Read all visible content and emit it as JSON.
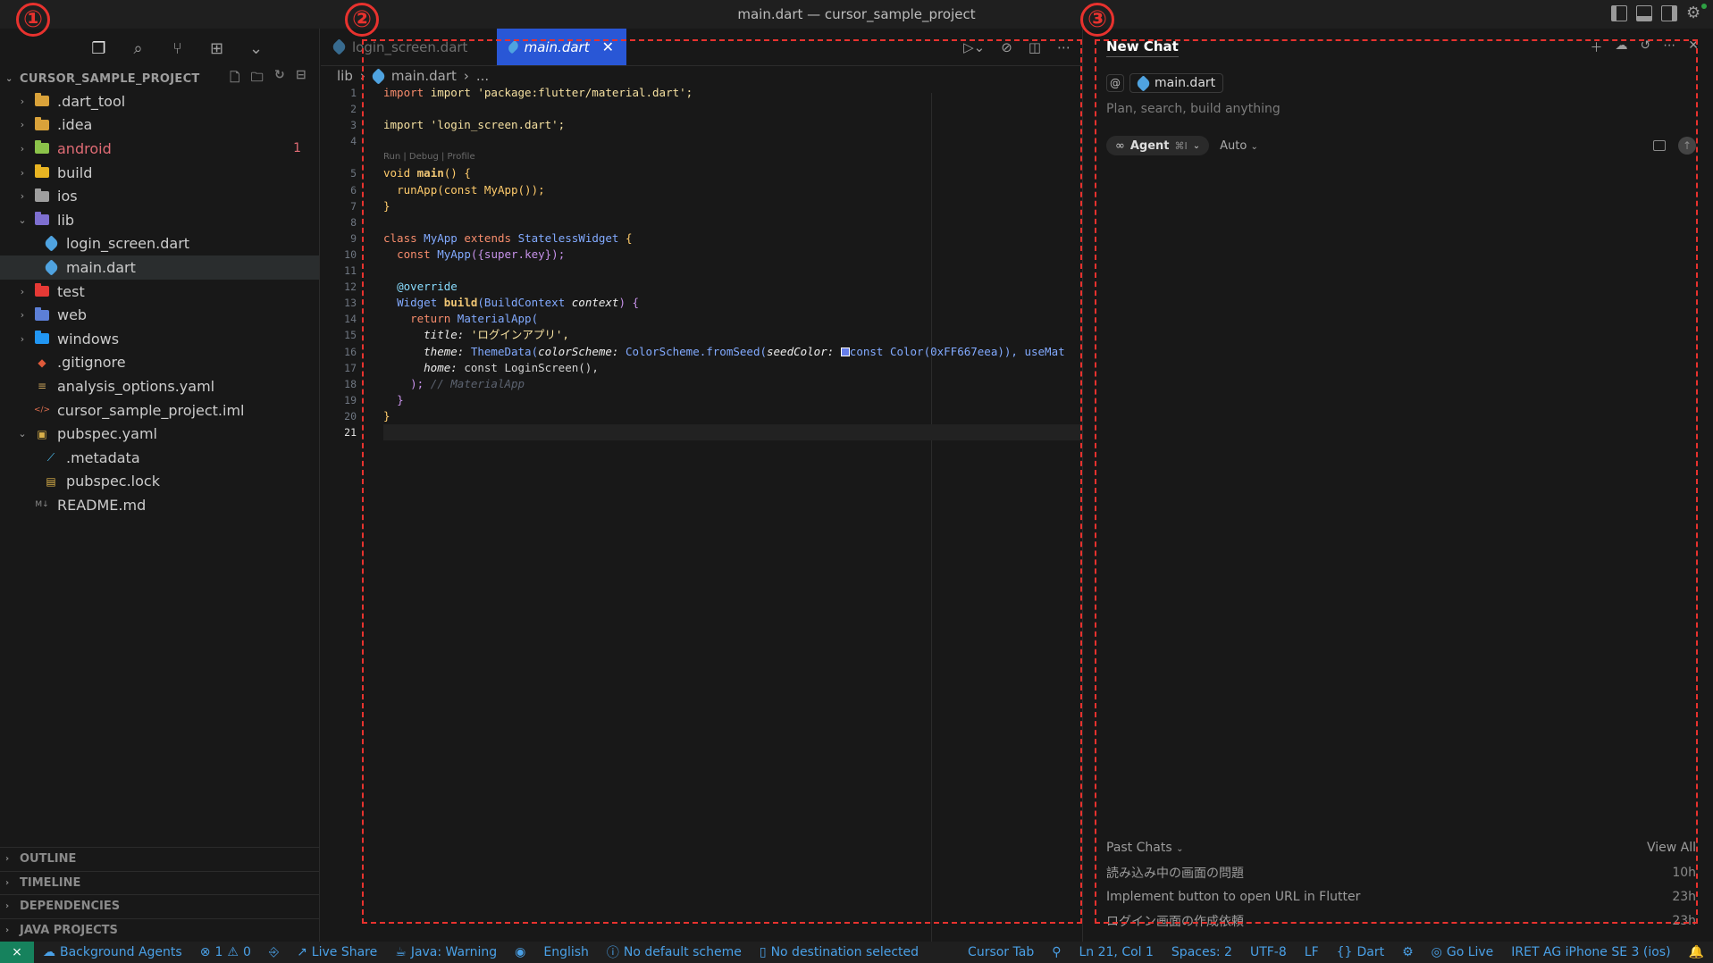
{
  "window": {
    "title": "main.dart — cursor_sample_project"
  },
  "annotations": {
    "n1": "①",
    "n2": "②",
    "n3": "③"
  },
  "explorer": {
    "title": "CURSOR_SAMPLE_PROJECT",
    "items": [
      {
        "label": ".dart_tool",
        "type": "folder",
        "color": "#d9a23a",
        "expanded": false
      },
      {
        "label": ".idea",
        "type": "folder",
        "color": "#d9a23a",
        "expanded": false
      },
      {
        "label": "android",
        "type": "folder",
        "color": "#8bc34a",
        "expanded": false,
        "badge": "1",
        "error": true
      },
      {
        "label": "build",
        "type": "folder",
        "color": "#e8b422",
        "expanded": false
      },
      {
        "label": "ios",
        "type": "folder",
        "color": "#9e9e9e",
        "expanded": false
      },
      {
        "label": "lib",
        "type": "folder",
        "color": "#7e6fd0",
        "expanded": true
      },
      {
        "label": "login_screen.dart",
        "type": "dart",
        "indent": 2
      },
      {
        "label": "main.dart",
        "type": "dart",
        "indent": 2,
        "selected": true
      },
      {
        "label": "test",
        "type": "folder",
        "color": "#e53935",
        "expanded": false
      },
      {
        "label": "web",
        "type": "folder",
        "color": "#5c7fd6",
        "expanded": false
      },
      {
        "label": "windows",
        "type": "folder",
        "color": "#2196f3",
        "expanded": false
      },
      {
        "label": ".gitignore",
        "type": "git"
      },
      {
        "label": "analysis_options.yaml",
        "type": "yaml"
      },
      {
        "label": "cursor_sample_project.iml",
        "type": "xml"
      },
      {
        "label": "pubspec.yaml",
        "type": "pubspec",
        "expanded": true
      },
      {
        "label": ".metadata",
        "type": "flutter",
        "indent": 2
      },
      {
        "label": "pubspec.lock",
        "type": "lock",
        "indent": 2
      },
      {
        "label": "README.md",
        "type": "md"
      }
    ],
    "sections": [
      "OUTLINE",
      "TIMELINE",
      "DEPENDENCIES",
      "JAVA PROJECTS"
    ]
  },
  "editor": {
    "tabs": [
      {
        "label": "login_screen.dart",
        "active": false
      },
      {
        "label": "main.dart",
        "active": true
      }
    ],
    "breadcrumb": [
      "lib",
      "main.dart",
      "..."
    ],
    "codelens": "Run | Debug | Profile",
    "lines": {
      "l1": "import 'package:flutter/material.dart';",
      "l3": "import 'login_screen.dart';",
      "l5a": "void",
      "l5b": "main",
      "l5c": "() {",
      "l6": "runApp(const MyApp());",
      "l7": "}",
      "l9a": "class",
      "l9b": "MyApp",
      "l9c": "extends",
      "l9d": "StatelessWidget",
      "l9e": "{",
      "l10a": "const",
      "l10b": "MyApp",
      "l10c": "({super.key});",
      "l12": "@override",
      "l13a": "Widget",
      "l13b": "build",
      "l13c": "(BuildContext",
      "l13d": "context",
      "l13e": ") {",
      "l14a": "return",
      "l14b": "MaterialApp(",
      "l15a": "title:",
      "l15b": "'ログインアプリ',",
      "l16a": "theme:",
      "l16b": "ThemeData(",
      "l16c": "colorScheme:",
      "l16d": "ColorScheme.fromSeed(",
      "l16e": "seedColor:",
      "l16f": "const Color(0xFF667eea)), useMat",
      "l17a": "home:",
      "l17b": "const LoginScreen(),",
      "l18a": ");",
      "l18b": "// MaterialApp",
      "l19": "}",
      "l20": "}"
    },
    "line_numbers": [
      "1",
      "2",
      "3",
      "4",
      "",
      "5",
      "6",
      "7",
      "8",
      "9",
      "10",
      "11",
      "12",
      "13",
      "14",
      "15",
      "16",
      "17",
      "18",
      "19",
      "20",
      "21"
    ],
    "current_line": "21"
  },
  "chat": {
    "title": "New Chat",
    "context_symbol": "@",
    "context_file": "main.dart",
    "placeholder": "Plan, search, build anything",
    "mode": "Agent",
    "mode_shortcut": "⌘I",
    "model": "Auto",
    "past_chats_label": "Past Chats",
    "view_all": "View All",
    "past_chats": [
      {
        "title": "読み込み中の画面の問題",
        "time": "10h"
      },
      {
        "title": "Implement button to open URL in Flutter",
        "time": "23h"
      },
      {
        "title": "ログイン画面の作成依頼",
        "time": "23h"
      }
    ]
  },
  "statusbar": {
    "background_agents": "Background Agents",
    "errors": "1",
    "warnings": "0",
    "live_share": "Live Share",
    "java": "Java: Warning",
    "language_ui": "English",
    "scheme": "No default scheme",
    "destination": "No destination selected",
    "cursor_tab": "Cursor Tab",
    "position": "Ln 21, Col 1",
    "spaces": "Spaces: 2",
    "encoding": "UTF-8",
    "eol": "LF",
    "language": "Dart",
    "go_live": "Go Live",
    "device": "IRET AG iPhone SE 3 (ios)"
  }
}
